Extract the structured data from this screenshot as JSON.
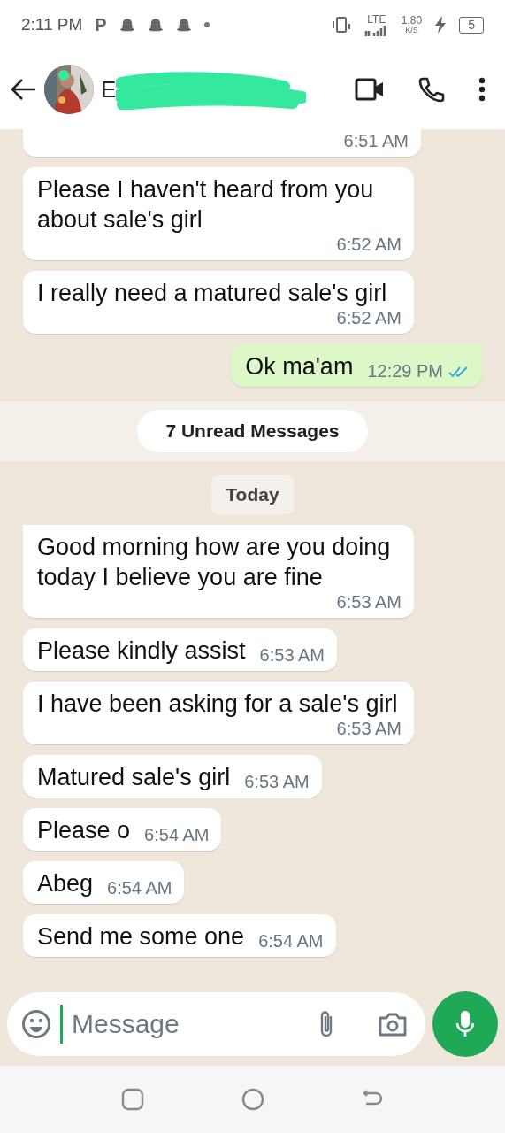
{
  "status_bar": {
    "time": "2:11 PM",
    "app_letter": "P",
    "network": "LTE",
    "speed": "1.80",
    "speed_unit": "K/S",
    "battery": "5"
  },
  "header": {
    "contact_name_visible": "E"
  },
  "messages": [
    {
      "kind": "partial",
      "time": "6:51 AM",
      "outgoing": false
    },
    {
      "kind": "message",
      "text": "Please I haven't heard from you about sale's girl",
      "time": "6:52 AM",
      "outgoing": false,
      "tail": false
    },
    {
      "kind": "message",
      "text": "I really need a matured sale's girl",
      "time": "6:52 AM",
      "outgoing": false,
      "tail": false
    },
    {
      "kind": "message",
      "text": "Ok ma'am",
      "time": "12:29 PM",
      "outgoing": true,
      "read": true,
      "tail": true
    },
    {
      "kind": "unread",
      "text": "7 Unread Messages"
    },
    {
      "kind": "date",
      "text": "Today"
    },
    {
      "kind": "message",
      "text": "Good morning how are you doing today I believe you are fine",
      "time": "6:53 AM",
      "outgoing": false,
      "tail": true
    },
    {
      "kind": "message",
      "text": "Please kindly assist",
      "time": "6:53 AM",
      "outgoing": false,
      "tail": false
    },
    {
      "kind": "message",
      "text": "I have been asking for a sale's girl",
      "time": "6:53 AM",
      "outgoing": false,
      "tail": false
    },
    {
      "kind": "message",
      "text": "Matured sale's girl",
      "time": "6:53 AM",
      "outgoing": false,
      "tail": false
    },
    {
      "kind": "message",
      "text": "Please o",
      "time": "6:54 AM",
      "outgoing": false,
      "tail": false
    },
    {
      "kind": "message",
      "text": "Abeg",
      "time": "6:54 AM",
      "outgoing": false,
      "tail": false
    },
    {
      "kind": "message",
      "text": "Send me some one",
      "time": "6:54 AM",
      "outgoing": false,
      "tail": false
    }
  ],
  "composer": {
    "placeholder": "Message"
  }
}
